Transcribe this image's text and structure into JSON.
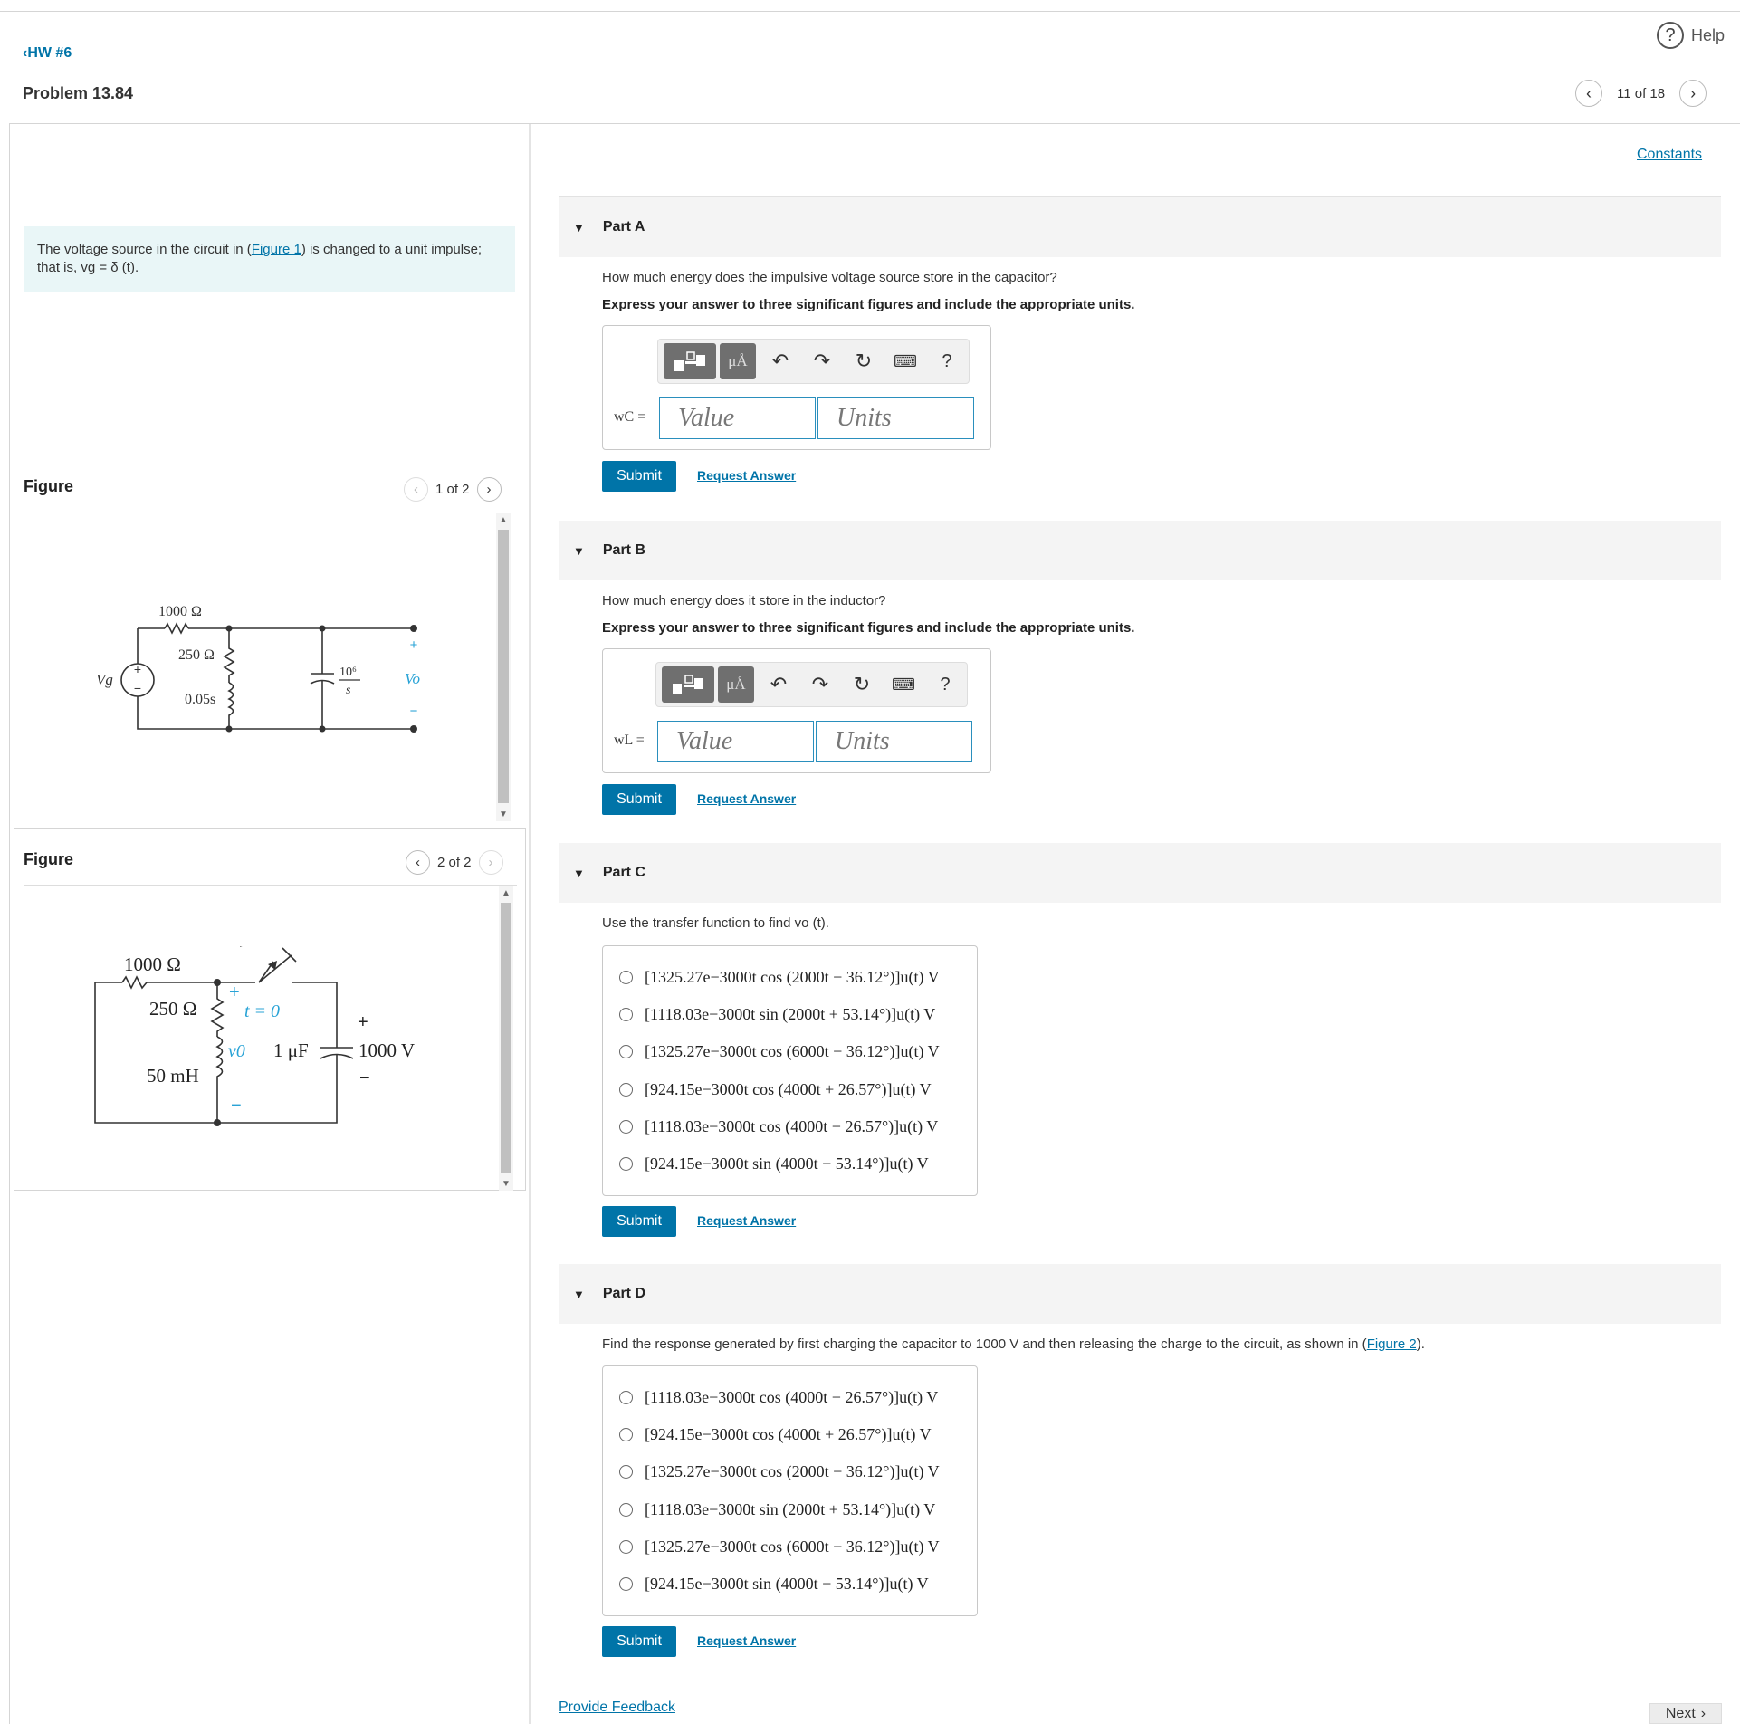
{
  "header": {
    "back_link": "HW #6",
    "problem_title": "Problem 13.84",
    "help": "Help",
    "pager": "11 of 18"
  },
  "intro": {
    "text_before": "The voltage source in the circuit in (",
    "link": "Figure 1",
    "text_after": ") is changed to a unit impulse;",
    "line2": "that is, vg = δ (t)."
  },
  "figure1": {
    "label": "Figure",
    "pager": "1 of 2",
    "r1": "1000 Ω",
    "r2": "250 Ω",
    "l1": "0.05s",
    "cap_num": "10⁶",
    "cap_den": "s",
    "src": "Vg",
    "out": "Vo",
    "plus": "+",
    "minus": "−"
  },
  "figure2": {
    "label": "Figure",
    "pager": "2 of 2",
    "r1": "1000 Ω",
    "r2": "250 Ω",
    "switch": "t = 0",
    "v0": "v0",
    "cap": "1 μF",
    "ind": "50 mH",
    "volt": "1000 V",
    "plus": "+",
    "minus": "−"
  },
  "constants": "Constants",
  "parts": {
    "a": {
      "title": "Part A",
      "question": "How much energy does the impulsive voltage source store in the capacitor?",
      "instruction": "Express your answer to three significant figures and include the appropriate units.",
      "var_label": "wC =",
      "value_placeholder": "Value",
      "units_placeholder": "Units"
    },
    "b": {
      "title": "Part B",
      "question": "How much energy does it store in the inductor?",
      "instruction": "Express your answer to three significant figures and include the appropriate units.",
      "var_label": "wL =",
      "value_placeholder": "Value",
      "units_placeholder": "Units"
    },
    "c": {
      "title": "Part C",
      "question": "Use the transfer function to find vo (t).",
      "options": [
        "[1325.27e−3000t cos (2000t − 36.12°)]u(t) V",
        "[1118.03e−3000t sin (2000t + 53.14°)]u(t) V",
        "[1325.27e−3000t cos (6000t − 36.12°)]u(t) V",
        "[924.15e−3000t cos (4000t + 26.57°)]u(t) V",
        "[1118.03e−3000t cos (4000t − 26.57°)]u(t) V",
        "[924.15e−3000t sin (4000t − 53.14°)]u(t) V"
      ]
    },
    "d": {
      "title": "Part D",
      "question_before": "Find the response generated by first charging the capacitor to 1000 V and then releasing the charge to the circuit, as shown in (",
      "question_link": "Figure 2",
      "question_after": ").",
      "options": [
        "[1118.03e−3000t cos (4000t − 26.57°)]u(t) V",
        "[924.15e−3000t cos (4000t + 26.57°)]u(t) V",
        "[1325.27e−3000t cos (2000t − 36.12°)]u(t) V",
        "[1118.03e−3000t sin (2000t + 53.14°)]u(t) V",
        "[1325.27e−3000t cos (6000t − 36.12°)]u(t) V",
        "[924.15e−3000t sin (4000t − 53.14°)]u(t) V"
      ]
    }
  },
  "buttons": {
    "submit": "Submit",
    "request_answer": "Request Answer"
  },
  "toolbar": {
    "units_glyph": "μÅ",
    "undo": "↶",
    "redo": "↷",
    "reset": "↻",
    "keyboard": "⌨",
    "help": "?"
  },
  "footer": {
    "feedback": "Provide Feedback",
    "next": "Next"
  },
  "colors": {
    "accent": "#0074a8",
    "intro_bg": "#e9f6f7",
    "part_header_bg": "#f4f4f4",
    "input_border": "#2a8fbd",
    "figure_blue": "#29a3d6"
  }
}
